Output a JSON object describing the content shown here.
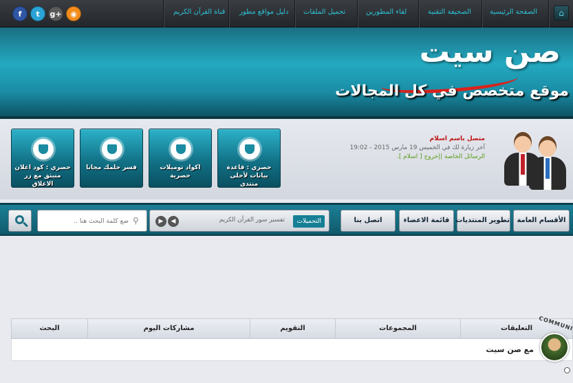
{
  "topnav": {
    "links": [
      "الصفحة الرئيسية",
      "الصحيفة التقنية",
      "لقاء المطورين",
      "تحميل الملفات",
      "دليل مواقع مطور",
      "قناة القرآن الكريم"
    ],
    "social": [
      {
        "icon": "rss-icon",
        "glyph": "◉",
        "color": "#f28c1c"
      },
      {
        "icon": "google-plus-icon",
        "glyph": "g+",
        "color": "#5a5a5a"
      },
      {
        "icon": "twitter-icon",
        "glyph": "t",
        "color": "#2aa3d6"
      },
      {
        "icon": "facebook-icon",
        "glyph": "f",
        "color": "#2f55a4"
      }
    ]
  },
  "banner": {
    "logo": "صن سيت",
    "slogan": "موقع متخصص في كل المجالات"
  },
  "info": {
    "username": "متصل باسم اسلام",
    "last_visit": "آخر زيارة لك في الخميس 19 مارس 2015 - 19:02",
    "links": "الرسائل الخاصة ||خروج [ اسلام ]."
  },
  "tiles": [
    "حصري : قاعدة بيانات لأحلى منتدى",
    "اكواد توميلات حصرية",
    "فسر حلمك مجانا",
    "حصري : كود اعلان منبثق مع زر الاغلاق"
  ],
  "menu": {
    "buttons": [
      "الأقسام العامة",
      "تطوير المنتديات",
      "قائمة الاعضاء",
      "اتصل بنا"
    ],
    "ticker_tag": "التحميلات",
    "ticker_text": "تفسير سور القرآن الكريم",
    "search_placeholder": "ضع كلمة البحث هنا .."
  },
  "stats": {
    "columns": [
      "التعليقات",
      "المجموعات",
      "التقويم",
      "مشاركات اليوم",
      "البحث"
    ],
    "row_text": "مع صن سيت"
  },
  "community": {
    "label": "COMMUNITY"
  }
}
